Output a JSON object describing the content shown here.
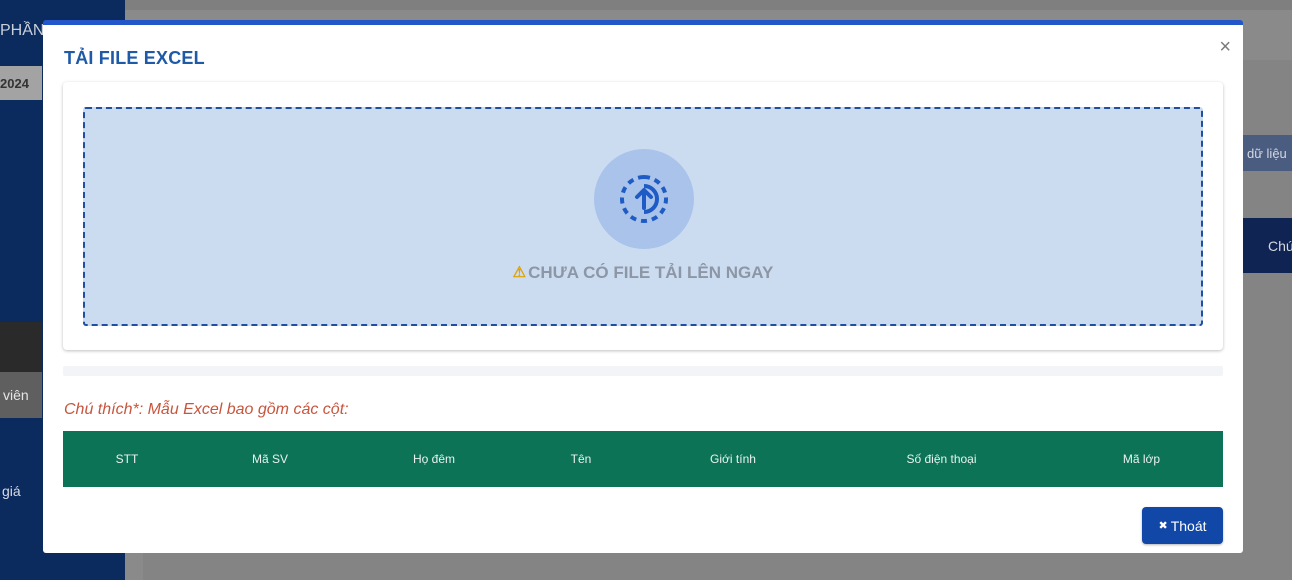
{
  "background": {
    "sidebar_title": "PHẦN",
    "year": "2024",
    "sidebar_item_vien": "viên",
    "sidebar_item_gia": "giá",
    "button_data": "dữ liệu",
    "button_chu": "Chú"
  },
  "modal": {
    "title": "TẢI FILE EXCEL",
    "close_icon": "×",
    "upload": {
      "icon": "upload-arrow-icon",
      "warning_icon": "⚠",
      "message": "CHƯA CÓ FILE TẢI LÊN NGAY"
    },
    "note": "Chú thích*: Mẫu Excel bao gồm các cột:",
    "columns": [
      "STT",
      "Mã SV",
      "Họ đêm",
      "Tên",
      "Giới tính",
      "Số điện thoại",
      "Mã lớp"
    ],
    "exit_icon": "✖",
    "exit_label": "Thoát"
  },
  "colors": {
    "accent": "#2357c9",
    "title": "#1e5aa8",
    "dropzone_bg": "#ccdcf0",
    "table_header": "#0d7357",
    "note": "#c8553d",
    "exit_button": "#1148a8"
  }
}
